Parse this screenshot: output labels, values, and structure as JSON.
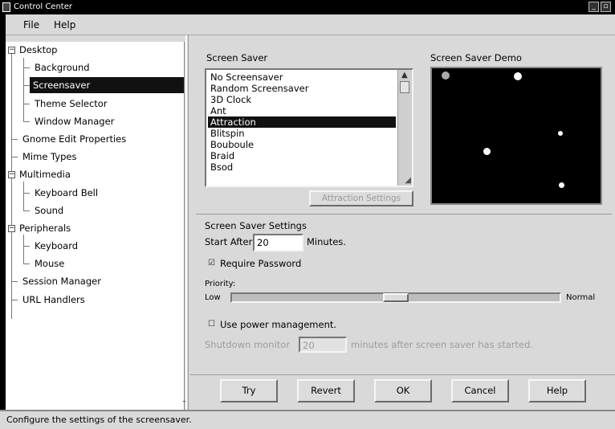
{
  "window": {
    "title": "Control Center",
    "minimize_glyph": "_",
    "maximize_glyph": "▫"
  },
  "menu": {
    "file": "File",
    "help": "Help"
  },
  "tree": {
    "items": [
      {
        "label": "Desktop",
        "expanded": true
      },
      {
        "label": "Background"
      },
      {
        "label": "Screensaver",
        "selected": true
      },
      {
        "label": "Theme Selector"
      },
      {
        "label": "Window Manager"
      },
      {
        "label": "Gnome Edit Properties"
      },
      {
        "label": "Mime Types"
      },
      {
        "label": "Multimedia",
        "expanded": true
      },
      {
        "label": "Keyboard Bell"
      },
      {
        "label": "Sound"
      },
      {
        "label": "Peripherals",
        "expanded": true
      },
      {
        "label": "Keyboard"
      },
      {
        "label": "Mouse"
      },
      {
        "label": "Session Manager"
      },
      {
        "label": "URL Handlers"
      }
    ],
    "expander_glyph": "−"
  },
  "screensaver": {
    "group_label": "Screen Saver",
    "items": [
      "No Screensaver",
      "Random Screensaver",
      "3D Clock",
      "Ant",
      "Attraction",
      "Blitspin",
      "Bouboule",
      "Braid",
      "Bsod"
    ],
    "selected": "Attraction",
    "settings_button": "Attraction Settings"
  },
  "demo": {
    "label": "Screen Saver Demo"
  },
  "settings": {
    "group_label": "Screen Saver Settings",
    "start_after_label": "Start After",
    "start_after_value": "20",
    "minutes_label": "Minutes.",
    "require_password_label": "Require Password",
    "require_password_checked": true,
    "priority_label": "Priority:",
    "priority_low": "Low",
    "priority_high": "Normal",
    "priority_level": 0.5,
    "power_management_label": "Use power management.",
    "power_management_checked": false,
    "shutdown_label": "Shutdown monitor",
    "shutdown_value": "20",
    "shutdown_suffix": "minutes after screen saver has started."
  },
  "buttons": {
    "try": "Try",
    "revert": "Revert",
    "ok": "OK",
    "cancel": "Cancel",
    "help": "Help"
  },
  "status": "Configure the settings of the screensaver."
}
